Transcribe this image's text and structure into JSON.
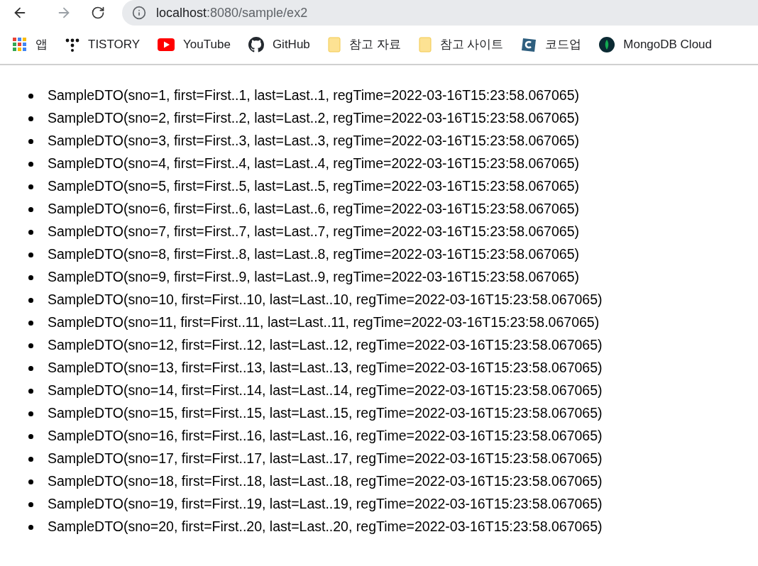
{
  "address_bar": {
    "host": "localhost",
    "path": ":8080/sample/ex2"
  },
  "bookmarks": [
    {
      "kind": "apps",
      "label": "앱"
    },
    {
      "kind": "tistory",
      "label": "TISTORY"
    },
    {
      "kind": "youtube",
      "label": "YouTube"
    },
    {
      "kind": "github",
      "label": "GitHub"
    },
    {
      "kind": "folder",
      "label": "참고 자료"
    },
    {
      "kind": "folder",
      "label": "참고 사이트"
    },
    {
      "kind": "codeup",
      "label": "코드업"
    },
    {
      "kind": "mongodb",
      "label": "MongoDB Cloud"
    }
  ],
  "items": [
    "SampleDTO(sno=1, first=First..1, last=Last..1, regTime=2022-03-16T15:23:58.067065)",
    "SampleDTO(sno=2, first=First..2, last=Last..2, regTime=2022-03-16T15:23:58.067065)",
    "SampleDTO(sno=3, first=First..3, last=Last..3, regTime=2022-03-16T15:23:58.067065)",
    "SampleDTO(sno=4, first=First..4, last=Last..4, regTime=2022-03-16T15:23:58.067065)",
    "SampleDTO(sno=5, first=First..5, last=Last..5, regTime=2022-03-16T15:23:58.067065)",
    "SampleDTO(sno=6, first=First..6, last=Last..6, regTime=2022-03-16T15:23:58.067065)",
    "SampleDTO(sno=7, first=First..7, last=Last..7, regTime=2022-03-16T15:23:58.067065)",
    "SampleDTO(sno=8, first=First..8, last=Last..8, regTime=2022-03-16T15:23:58.067065)",
    "SampleDTO(sno=9, first=First..9, last=Last..9, regTime=2022-03-16T15:23:58.067065)",
    "SampleDTO(sno=10, first=First..10, last=Last..10, regTime=2022-03-16T15:23:58.067065)",
    "SampleDTO(sno=11, first=First..11, last=Last..11, regTime=2022-03-16T15:23:58.067065)",
    "SampleDTO(sno=12, first=First..12, last=Last..12, regTime=2022-03-16T15:23:58.067065)",
    "SampleDTO(sno=13, first=First..13, last=Last..13, regTime=2022-03-16T15:23:58.067065)",
    "SampleDTO(sno=14, first=First..14, last=Last..14, regTime=2022-03-16T15:23:58.067065)",
    "SampleDTO(sno=15, first=First..15, last=Last..15, regTime=2022-03-16T15:23:58.067065)",
    "SampleDTO(sno=16, first=First..16, last=Last..16, regTime=2022-03-16T15:23:58.067065)",
    "SampleDTO(sno=17, first=First..17, last=Last..17, regTime=2022-03-16T15:23:58.067065)",
    "SampleDTO(sno=18, first=First..18, last=Last..18, regTime=2022-03-16T15:23:58.067065)",
    "SampleDTO(sno=19, first=First..19, last=Last..19, regTime=2022-03-16T15:23:58.067065)",
    "SampleDTO(sno=20, first=First..20, last=Last..20, regTime=2022-03-16T15:23:58.067065)"
  ]
}
